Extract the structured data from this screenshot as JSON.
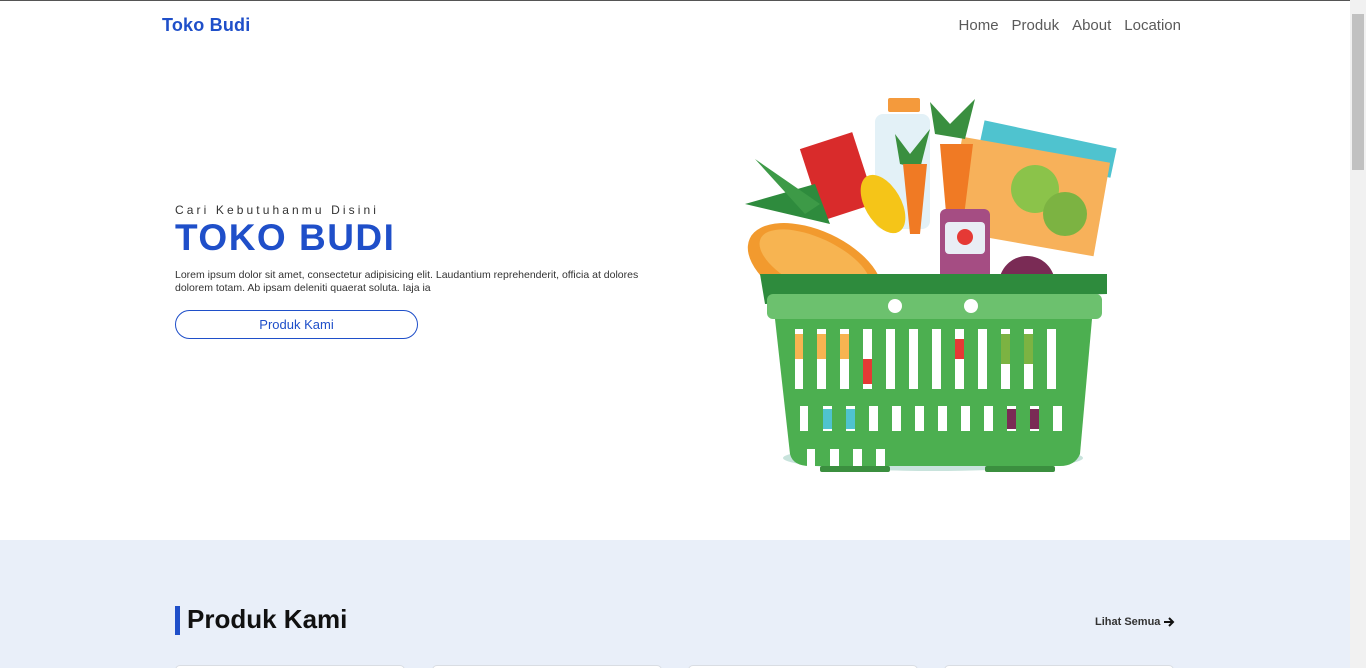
{
  "navbar": {
    "brand": "Toko Budi",
    "links": [
      "Home",
      "Produk",
      "About",
      "Location"
    ]
  },
  "hero": {
    "tagline": "Cari Kebutuhanmu Disini",
    "title": "TOKO BUDI",
    "description": "Lorem ipsum dolor sit amet, consectetur adipisicing elit. Laudantium reprehenderit, officia at dolores dolorem totam. Ab ipsam deleniti quaerat soluta. Iaja ia",
    "button_label": "Produk Kami",
    "image_icon": "grocery-basket-illustration"
  },
  "products": {
    "title": "Produk Kami",
    "see_all": "Lihat Semua"
  },
  "colors": {
    "accent": "#1f4fc9",
    "section_bg": "#e9eff9",
    "basket_green": "#4caf50"
  }
}
